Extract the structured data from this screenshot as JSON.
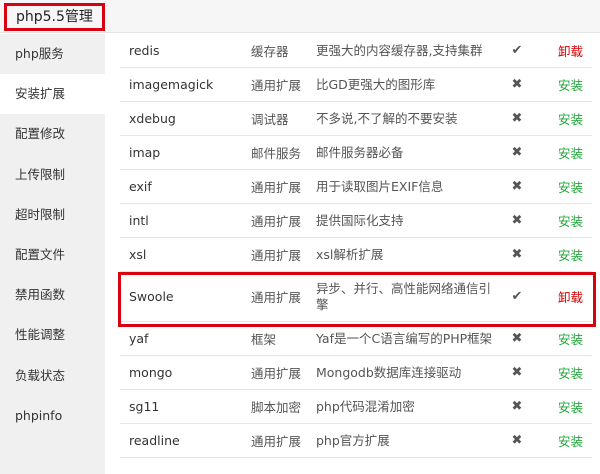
{
  "header": {
    "title": "php5.5管理"
  },
  "sidebar": {
    "items": [
      {
        "id": "php-service",
        "label": "php服务"
      },
      {
        "id": "install-ext",
        "label": "安装扩展",
        "active": true
      },
      {
        "id": "config-edit",
        "label": "配置修改"
      },
      {
        "id": "upload-limit",
        "label": "上传限制"
      },
      {
        "id": "timeout-limit",
        "label": "超时限制"
      },
      {
        "id": "config-file",
        "label": "配置文件"
      },
      {
        "id": "disabled-functions",
        "label": "禁用函数"
      },
      {
        "id": "performance",
        "label": "性能调整"
      },
      {
        "id": "load-status",
        "label": "负载状态"
      },
      {
        "id": "phpinfo",
        "label": "phpinfo"
      }
    ]
  },
  "extensions": [
    {
      "id": "redis",
      "name": "redis",
      "type": "缓存器",
      "desc": "更强大的内容缓存器,支持集群",
      "installed": true,
      "action": "卸载"
    },
    {
      "id": "imagemagick",
      "name": "imagemagick",
      "type": "通用扩展",
      "desc": "比GD更强大的图形库",
      "installed": false,
      "action": "安装"
    },
    {
      "id": "xdebug",
      "name": "xdebug",
      "type": "调试器",
      "desc": "不多说,不了解的不要安装",
      "installed": false,
      "action": "安装"
    },
    {
      "id": "imap",
      "name": "imap",
      "type": "邮件服务",
      "desc": "邮件服务器必备",
      "installed": false,
      "action": "安装"
    },
    {
      "id": "exif",
      "name": "exif",
      "type": "通用扩展",
      "desc": "用于读取图片EXIF信息",
      "installed": false,
      "action": "安装"
    },
    {
      "id": "intl",
      "name": "intl",
      "type": "通用扩展",
      "desc": "提供国际化支持",
      "installed": false,
      "action": "安装"
    },
    {
      "id": "xsl",
      "name": "xsl",
      "type": "通用扩展",
      "desc": "xsl解析扩展",
      "installed": false,
      "action": "安装"
    },
    {
      "id": "swoole",
      "name": "Swoole",
      "type": "通用扩展",
      "desc": "异步、并行、高性能网络通信引擎",
      "installed": true,
      "action": "卸载"
    },
    {
      "id": "yaf",
      "name": "yaf",
      "type": "框架",
      "desc": "Yaf是一个C语言编写的PHP框架",
      "installed": false,
      "action": "安装"
    },
    {
      "id": "mongo",
      "name": "mongo",
      "type": "通用扩展",
      "desc": "Mongodb数据库连接驱动",
      "installed": false,
      "action": "安装"
    },
    {
      "id": "sg11",
      "name": "sg11",
      "type": "脚本加密",
      "desc": "php代码混淆加密",
      "installed": false,
      "action": "安装"
    },
    {
      "id": "readline",
      "name": "readline",
      "type": "通用扩展",
      "desc": "php官方扩展",
      "installed": false,
      "action": "安装"
    }
  ],
  "icons": {
    "installed": "check-icon",
    "not_installed": "cross-icon"
  },
  "colors": {
    "highlight": "#d9000f",
    "install": "#20a53a",
    "uninstall": "#d00000"
  }
}
